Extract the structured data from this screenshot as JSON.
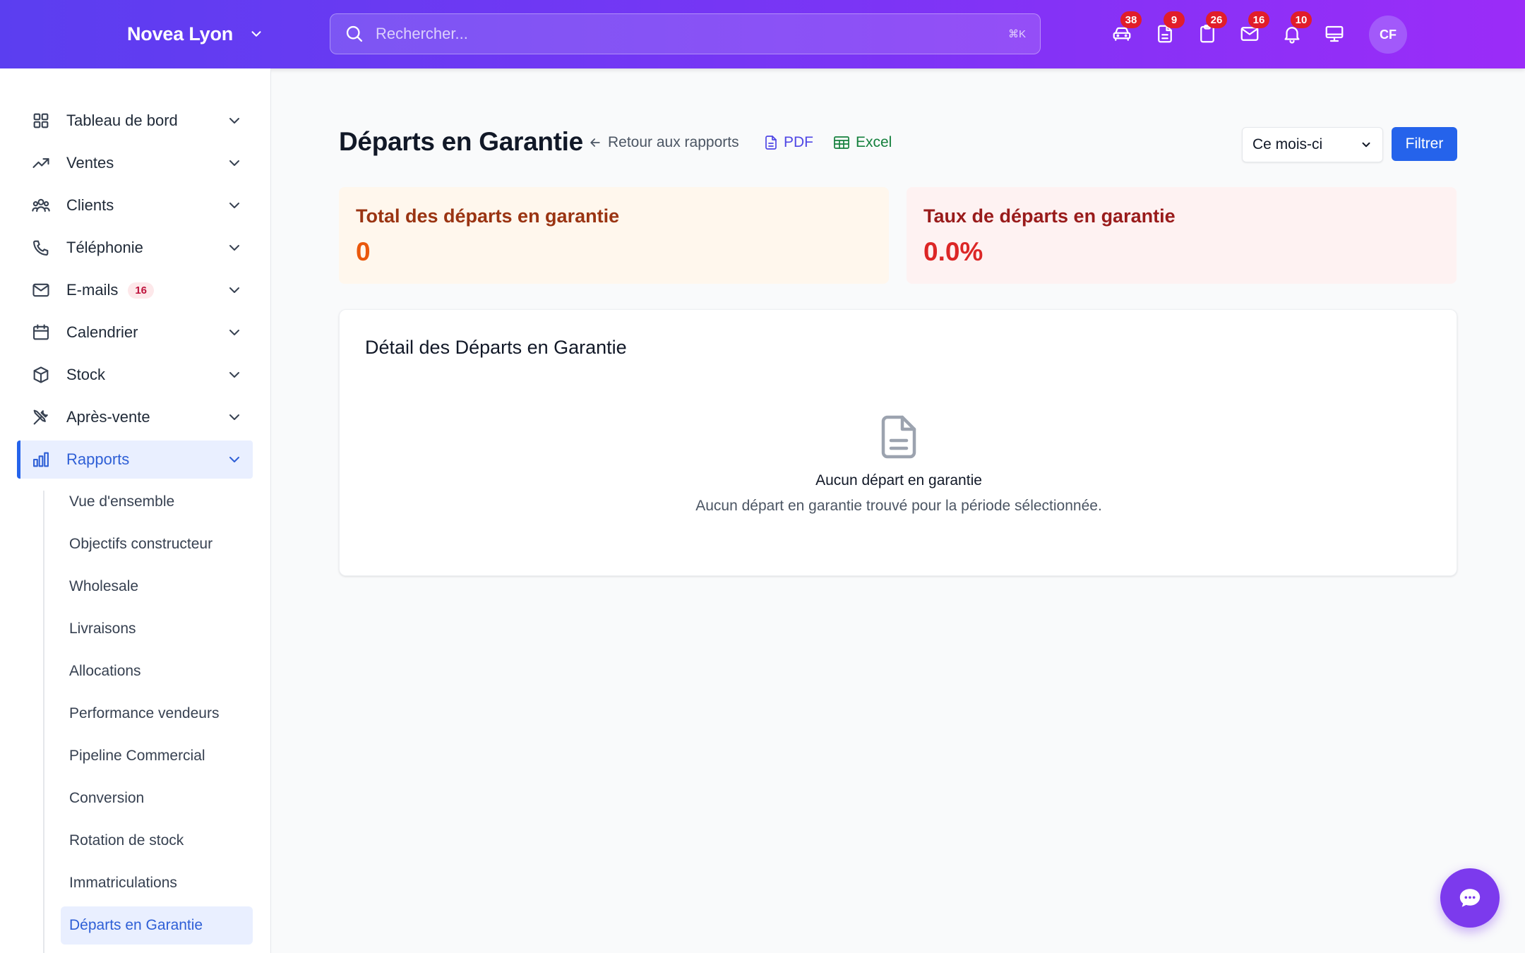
{
  "header": {
    "brand": "Novea Lyon",
    "search_placeholder": "Rechercher...",
    "search_shortcut": "⌘K",
    "icons": [
      {
        "name": "car-icon",
        "badge": "38"
      },
      {
        "name": "document-icon",
        "badge": "9"
      },
      {
        "name": "clipboard-icon",
        "badge": "26"
      },
      {
        "name": "mail-icon",
        "badge": "16"
      },
      {
        "name": "bell-icon",
        "badge": "10"
      },
      {
        "name": "monitor-icon",
        "badge": ""
      }
    ],
    "avatar_initials": "CF"
  },
  "sidebar": {
    "items": [
      {
        "label": "Tableau de bord",
        "icon": "grid-icon"
      },
      {
        "label": "Ventes",
        "icon": "trending-up-icon"
      },
      {
        "label": "Clients",
        "icon": "users-icon"
      },
      {
        "label": "Téléphonie",
        "icon": "phone-icon"
      },
      {
        "label": "E-mails",
        "icon": "mail-icon",
        "badge": "16"
      },
      {
        "label": "Calendrier",
        "icon": "calendar-icon"
      },
      {
        "label": "Stock",
        "icon": "box-icon"
      },
      {
        "label": "Après-vente",
        "icon": "tools-icon"
      },
      {
        "label": "Rapports",
        "icon": "bar-chart-icon",
        "active": true
      }
    ],
    "subitems": [
      "Vue d'ensemble",
      "Objectifs constructeur",
      "Wholesale",
      "Livraisons",
      "Allocations",
      "Performance vendeurs",
      "Pipeline Commercial",
      "Conversion",
      "Rotation de stock",
      "Immatriculations",
      "Départs en Garantie"
    ]
  },
  "main": {
    "title": "Départs en Garantie",
    "back_link": "Retour aux rapports",
    "pdf_label": "PDF",
    "excel_label": "Excel",
    "period_selected": "Ce mois-ci",
    "filter_label": "Filtrer",
    "stats": [
      {
        "title": "Total des départs en garantie",
        "value": "0",
        "accent": "#ea580c"
      },
      {
        "title": "Taux de départs en garantie",
        "value": "0.0%",
        "accent": "#dc2626"
      }
    ],
    "detail": {
      "title": "Détail des Départs en Garantie",
      "empty_title": "Aucun départ en garantie",
      "empty_desc": "Aucun départ en garantie trouvé pour la période sélectionnée."
    }
  },
  "colors": {
    "primary": "#2563eb",
    "header_gradient_start": "#5b3ef0",
    "header_gradient_end": "#9b2cf8",
    "chat": "#7c3aed"
  }
}
